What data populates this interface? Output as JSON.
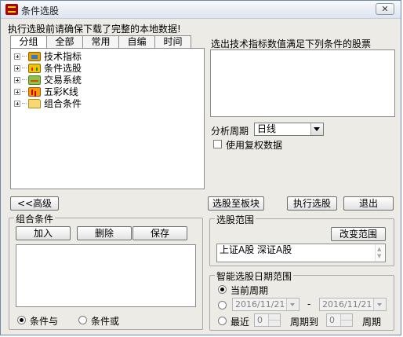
{
  "window": {
    "title": "条件选股",
    "close_label": "✕"
  },
  "notice": "执行选股前请确保下载了完整的本地数据!",
  "tabs": [
    {
      "label": "分组"
    },
    {
      "label": "全部"
    },
    {
      "label": "常用"
    },
    {
      "label": "自编"
    },
    {
      "label": "时间"
    }
  ],
  "tree": [
    {
      "label": "技术指标",
      "icon": "indicator-icon"
    },
    {
      "label": "条件选股",
      "icon": "condition-icon"
    },
    {
      "label": "交易系统",
      "icon": "trading-system-icon"
    },
    {
      "label": "五彩K线",
      "icon": "candlestick-icon"
    },
    {
      "label": "组合条件",
      "icon": "folder-icon"
    }
  ],
  "right": {
    "desc_label": "选出技术指标数值满足下列条件的股票",
    "period_label": "分析周期",
    "period_value": "日线",
    "use_adjusted_label": "使用复权数据"
  },
  "buttons": {
    "advanced": "<<高级",
    "to_block": "选股至板块",
    "execute": "执行选股",
    "exit": "退出",
    "add": "加入",
    "delete": "删除",
    "save": "保存",
    "change_range": "改变范围"
  },
  "combo": {
    "title": "组合条件",
    "and_label": "条件与",
    "or_label": "条件或"
  },
  "range": {
    "title": "选股范围",
    "value": "上证A股 深证A股"
  },
  "date_range": {
    "title": "智能选股日期范围",
    "current_period_label": "当前周期",
    "start_date": "2016/11/21",
    "dash": "-",
    "end_date": "2016/11/21",
    "recent_label": "最近",
    "recent_value": "0",
    "period_to_label": "周期到",
    "period_to_value": "0",
    "period_label": "周期"
  }
}
